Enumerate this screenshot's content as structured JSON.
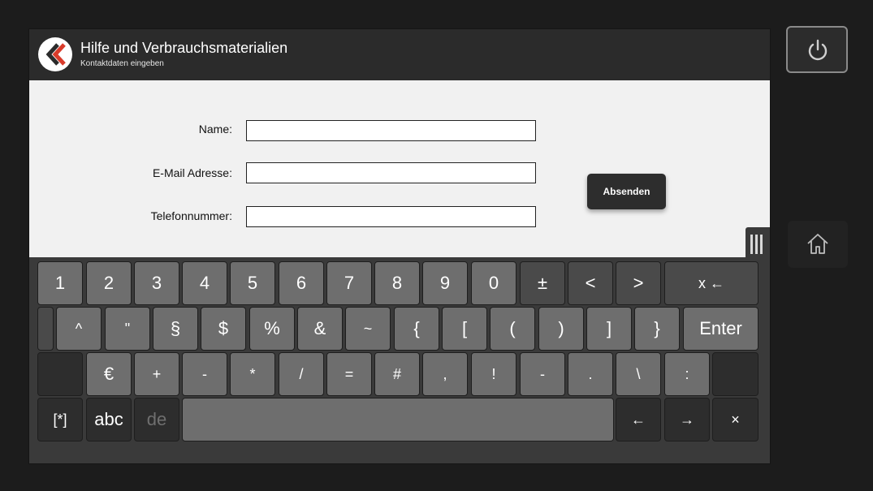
{
  "header": {
    "title": "Hilfe und Verbrauchsmaterialien",
    "subtitle": "Kontaktdaten eingeben",
    "logo_icon": "back-chevrons-icon",
    "accent_color": "#d93b2b"
  },
  "form": {
    "name_label": "Name:",
    "name_value": "",
    "email_label": "E-Mail Adresse:",
    "email_value": "",
    "phone_label": "Telefonnummer:",
    "phone_value": "",
    "submit_label": "Absenden"
  },
  "side": {
    "power_icon": "power-icon",
    "home_icon": "home-icon",
    "grip_icon": "keyboard-grip-icon"
  },
  "keyboard": {
    "row1": [
      "1",
      "2",
      "3",
      "4",
      "5",
      "6",
      "7",
      "8",
      "9",
      "0",
      "±",
      "<",
      ">",
      "x ←"
    ],
    "row2": [
      "^",
      "\"",
      "§",
      "$",
      "%",
      "&",
      "~",
      "{",
      "[",
      "(",
      ")",
      "]",
      "}",
      "Enter"
    ],
    "row3": [
      "€",
      "+",
      "-",
      "*",
      "/",
      "=",
      "#",
      ",",
      "!",
      "-",
      ".",
      "\\",
      ":"
    ],
    "row4": [
      "[*]",
      "abc",
      "de",
      "←",
      "→",
      "×"
    ]
  }
}
